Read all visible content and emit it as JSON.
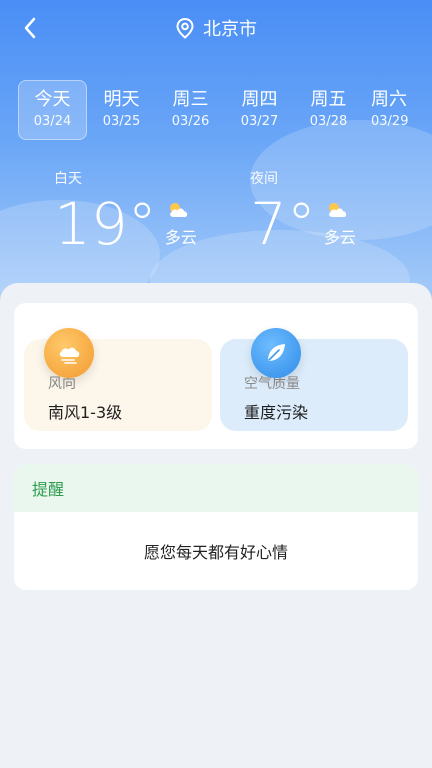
{
  "header": {
    "city": "北京市"
  },
  "days": [
    {
      "name": "今天",
      "date": "03/24",
      "active": true
    },
    {
      "name": "明天",
      "date": "03/25"
    },
    {
      "name": "周三",
      "date": "03/26"
    },
    {
      "name": "周四",
      "date": "03/27"
    },
    {
      "name": "周五",
      "date": "03/28"
    },
    {
      "name": "周六",
      "date": "03/29"
    }
  ],
  "today": {
    "day": {
      "label": "白天",
      "temp": "19°",
      "condition": "多云"
    },
    "night": {
      "label": "夜间",
      "temp": "7°",
      "condition": "多云"
    }
  },
  "info": {
    "wind": {
      "label": "风向",
      "value": "南风1-3级",
      "icon": "wind-cloud-icon"
    },
    "air": {
      "label": "空气质量",
      "value": "重度污染",
      "icon": "leaf-icon"
    }
  },
  "reminder": {
    "title": "提醒",
    "message": "愿您每天都有好心情"
  },
  "colors": {
    "hero_top": "#4a8ef6",
    "wind_badge": "#f5a73b",
    "air_badge": "#3d9bf2",
    "reminder_accent": "#2e9d4e"
  }
}
